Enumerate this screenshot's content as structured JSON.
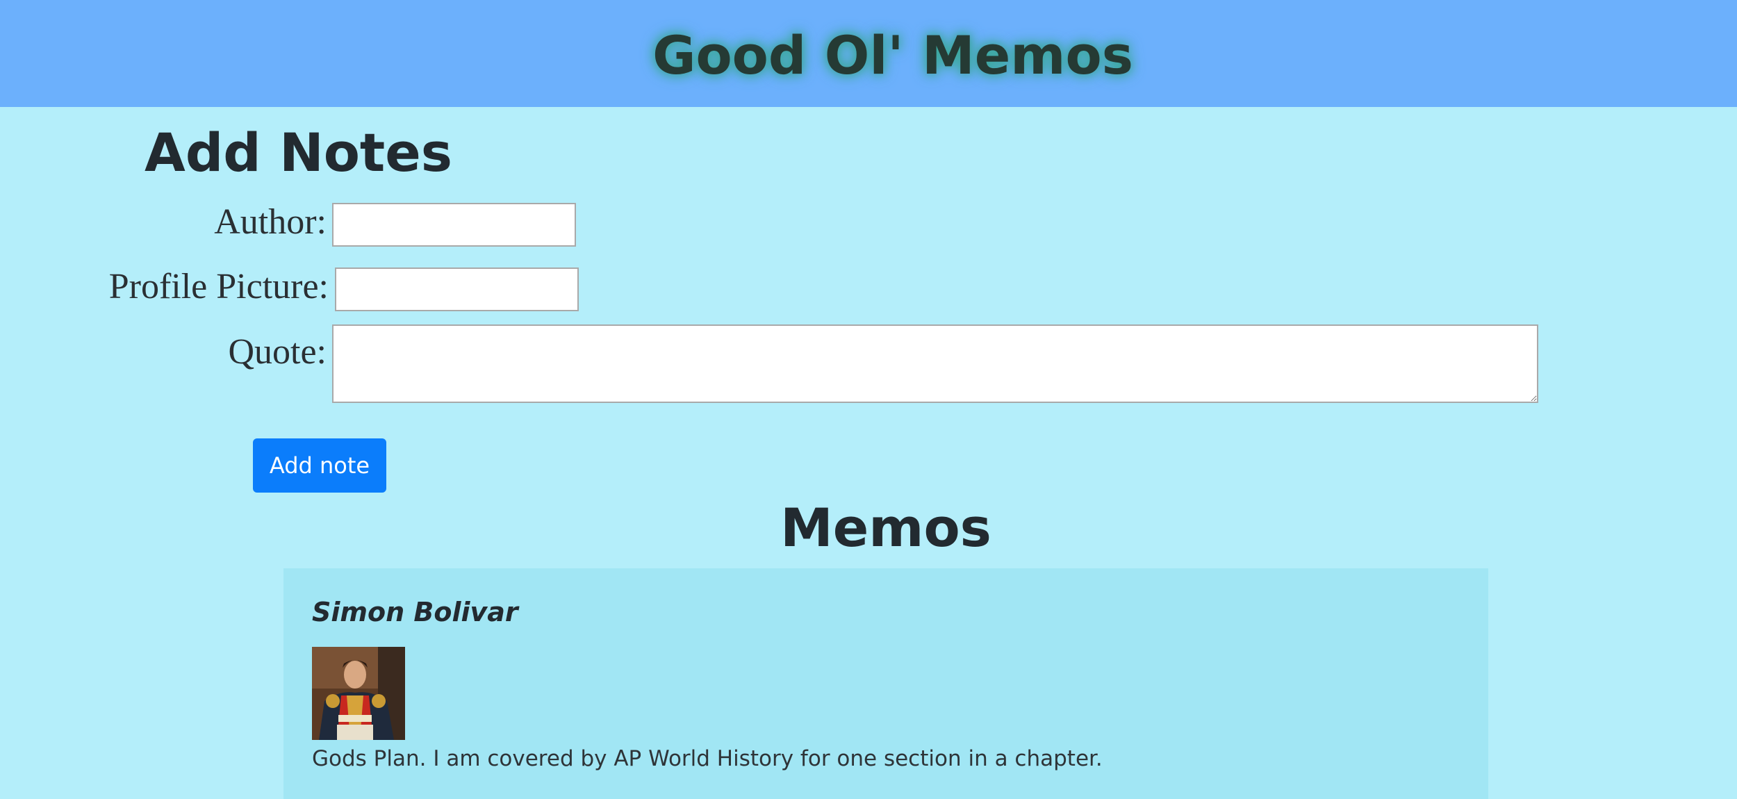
{
  "header": {
    "title": "Good Ol' Memos"
  },
  "form": {
    "title": "Add Notes",
    "author_label": "Author:",
    "author_value": "",
    "picture_label": "Profile Picture:",
    "picture_value": "",
    "quote_label": "Quote:",
    "quote_value": "",
    "submit_label": "Add note"
  },
  "memos": {
    "title": "Memos",
    "items": [
      {
        "author": "Simon Bolivar",
        "quote": "Gods Plan. I am covered by AP World History for one section in a chapter."
      }
    ]
  },
  "colors": {
    "header_bg": "#6cb0fc",
    "page_bg": "#b4eefa",
    "card_bg": "#a1e6f4",
    "button_bg": "#0b7dfb",
    "title_glow": "#3aa89a"
  }
}
